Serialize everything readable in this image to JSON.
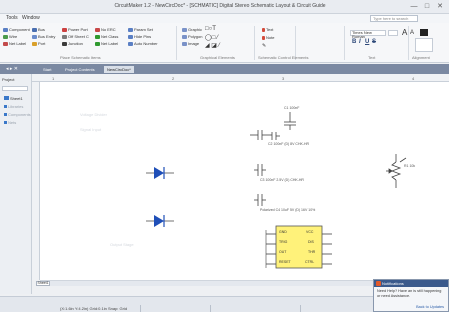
{
  "window": {
    "title": "CircuitMaker 1.2 - NewCircDoc* - [SCHMATIC] Digital Stereo Schematic Layout & Circuit Guide",
    "controls": [
      "—",
      "□",
      "✕"
    ]
  },
  "menu": {
    "items": [
      "Tools",
      "Window"
    ],
    "search_placeholder": "Type here to search"
  },
  "ribbon": {
    "col1": [
      "Component",
      "Wire",
      "Net Label"
    ],
    "col2": [
      "Bus",
      "Bus Entry",
      "Port"
    ],
    "col3": [
      "Power Port",
      "Off Sheet C",
      "Junction"
    ],
    "col4": [
      "No ERC",
      "Net Class",
      "Net Label"
    ],
    "col5": [
      "Param Set",
      "Hide Pins",
      "Auto Number"
    ],
    "col6": [
      "Graphic",
      "Polygon",
      "Image"
    ],
    "col7": [
      "Text",
      "Note"
    ],
    "font_name": "Times New Roman",
    "format_buttons": [
      "B",
      "I",
      "U",
      "S"
    ],
    "font_grow": "A",
    "font_shrink": "A",
    "group_labels": [
      "Place Schematic Items",
      "Graphical Elements",
      "Schematic Control Elements",
      "Text",
      "Alignment"
    ]
  },
  "tabs": {
    "items": [
      "Start",
      "Project Contents",
      "NewCircDoc*"
    ]
  },
  "left_panel": {
    "header": "Project",
    "rows": [
      "Sheet1",
      "Libraries",
      "Components",
      "Nets"
    ]
  },
  "ruler": {
    "marks": [
      "1",
      "2",
      "3",
      "4"
    ]
  },
  "schematic": {
    "labels": {
      "cap_top": "C1 100nF",
      "cap_mid": "C2 100nF (D) 8V CHK-HR",
      "cap_b": "C3 100nF 2.5V (D) CHK-HR",
      "cap_c": "Polarized C4 10uF 5V (D) 16V 10%",
      "pot": "R1 10k",
      "ic_pins_left": [
        "GND",
        "TRIG",
        "OUT",
        "RESET"
      ],
      "ic_pins_right": [
        "VCC",
        "DIS",
        "THR",
        "CTRL"
      ],
      "faint_notes": [
        "Voltage Divider",
        "Signal Input",
        "Output Stage"
      ]
    }
  },
  "sheet_tab": "Sheet1",
  "status": {
    "text": "(X:1.6in Y:4.2in) Grid:0.1in  Snap: Grid"
  },
  "notification": {
    "title": "Notifications",
    "body": "Need Help? Have an is still happening or need Assistance.",
    "link": "Back to Updates"
  },
  "colors": {
    "accent": "#3b5a8c",
    "diode": "#1f4fb8",
    "ic_fill": "#fff27a"
  }
}
